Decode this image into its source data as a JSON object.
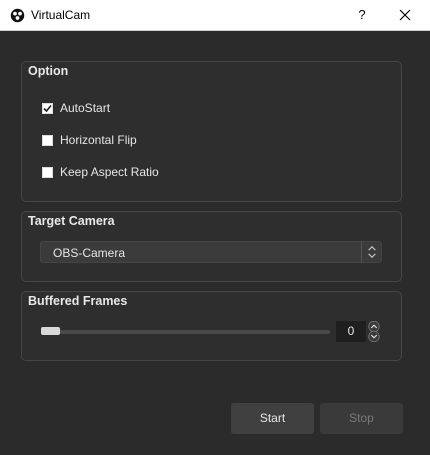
{
  "window": {
    "title": "VirtualCam",
    "help_label": "?",
    "icons": {
      "app": "obs-logo-icon",
      "close": "close-icon"
    }
  },
  "option": {
    "title": "Option",
    "items": [
      {
        "label": "AutoStart",
        "checked": true
      },
      {
        "label": "Horizontal Flip",
        "checked": false
      },
      {
        "label": "Keep Aspect Ratio",
        "checked": false
      }
    ]
  },
  "target_camera": {
    "title": "Target Camera",
    "selected": "OBS-Camera"
  },
  "buffered_frames": {
    "title": "Buffered Frames",
    "value": "0"
  },
  "buttons": {
    "start": "Start",
    "stop": "Stop"
  }
}
